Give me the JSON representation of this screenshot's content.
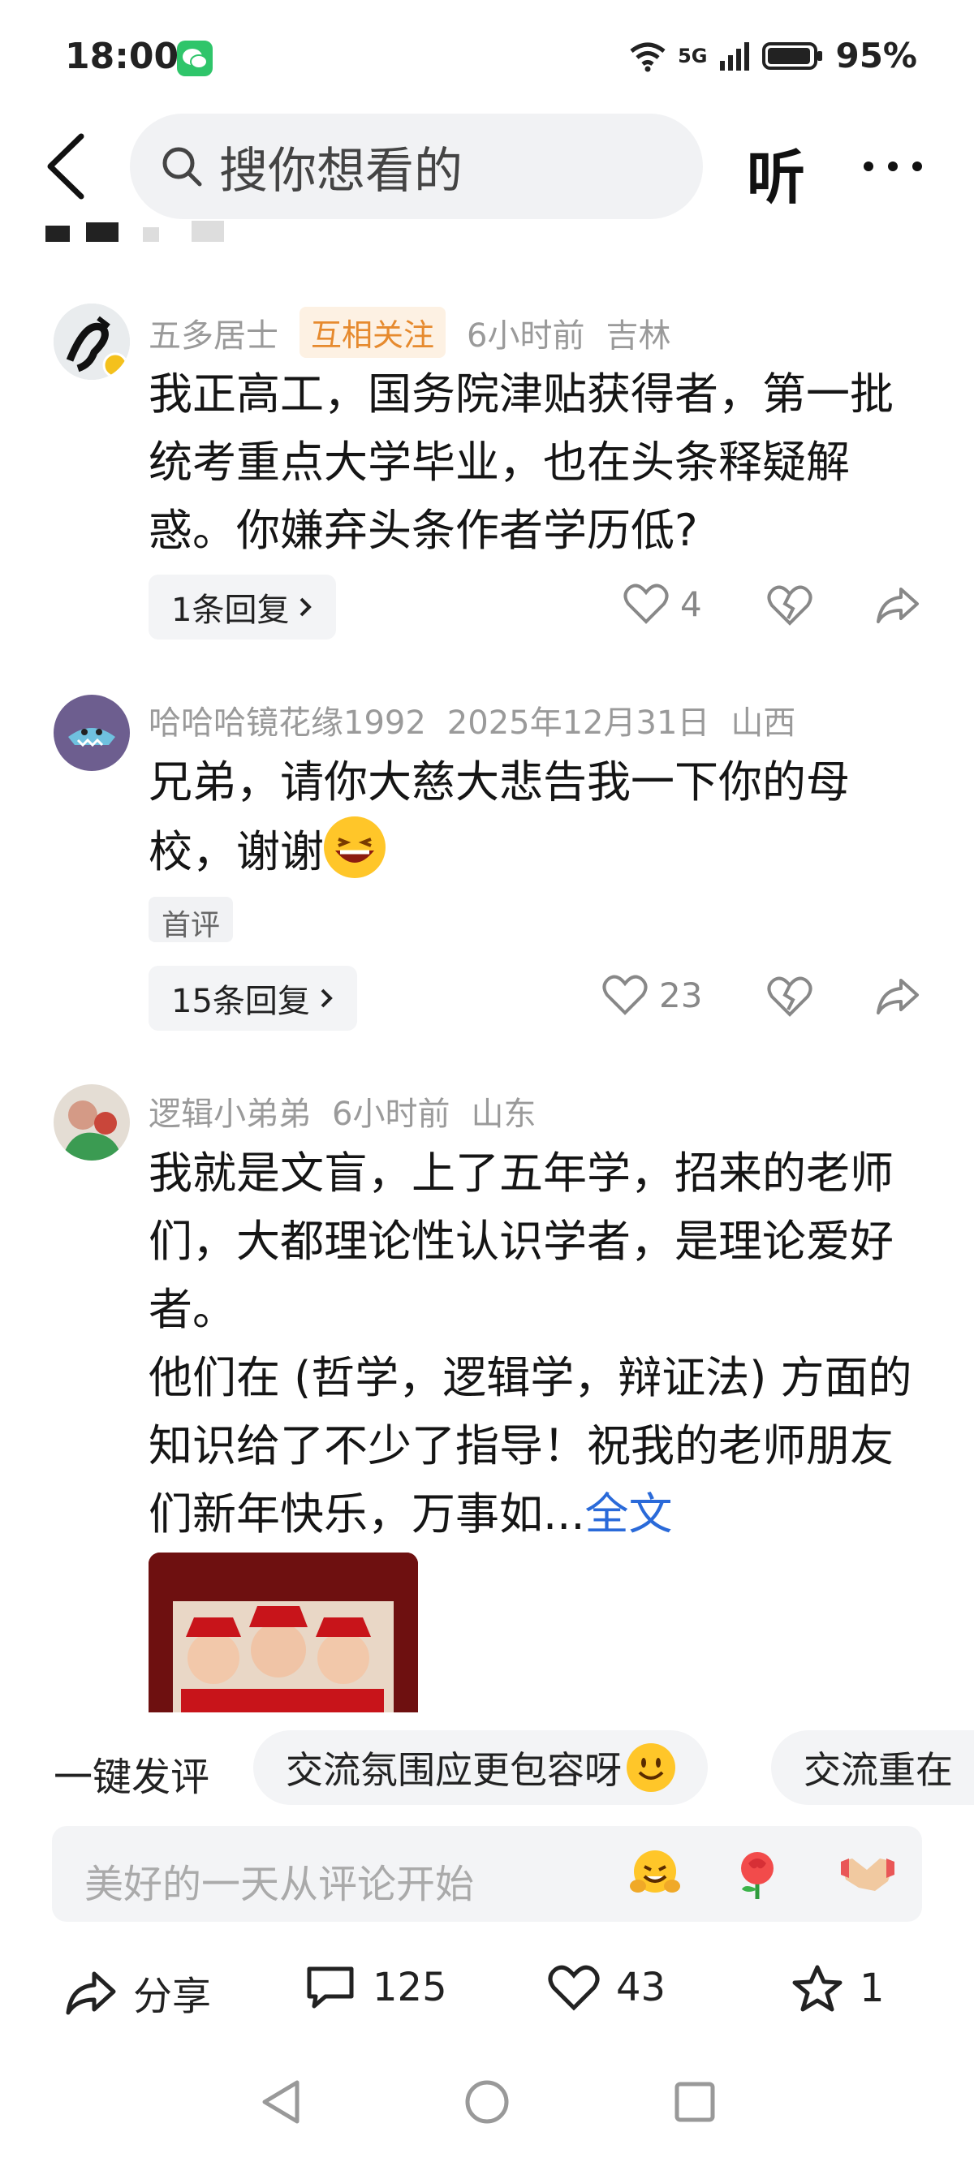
{
  "status_bar": {
    "time": "18:00",
    "app_badge": "wechat-icon",
    "network": "5G",
    "battery": "95%"
  },
  "header": {
    "search_placeholder": "搜你想看的",
    "listen_label": "听",
    "more_label": "···"
  },
  "comments": [
    {
      "user": "五多居士",
      "badge": "互相关注",
      "time": "6小时前",
      "location": "吉林",
      "text": "我正高工，国务院津贴获得者，第一批统考重点大学毕业，也在头条释疑解惑。你嫌弃头条作者学历低?",
      "replies": "1条回复",
      "likes": "4"
    },
    {
      "user": "哈哈哈镜花缘1992",
      "time": "2025年12月31日",
      "location": "山西",
      "text_line1": "兄弟，请你大慈大悲告我一下你的母",
      "text_line2": "校，谢谢",
      "tag": "首评",
      "replies": "15条回复",
      "likes": "23"
    },
    {
      "user": "逻辑小弟弟",
      "time": "6小时前",
      "location": "山东",
      "text_p1": "我就是文盲，上了五年学，招来的老师们，大都理论性认识学者，是理论爱好者。",
      "text_p2": "他们在 (哲学，逻辑学，辩证法) 方面的知识给了不少了指导！祝我的老师朋友们新年快乐，万事如...",
      "fulltext": "全文"
    }
  ],
  "quick_reply": {
    "label": "一键发评",
    "chips": [
      "交流氛围应更包容呀",
      "交流重在"
    ]
  },
  "comment_box": {
    "placeholder": "美好的一天从评论开始"
  },
  "bottom_bar": {
    "share_label": "分享",
    "comments_count": "125",
    "likes_count": "43",
    "favorites_count": "1"
  }
}
